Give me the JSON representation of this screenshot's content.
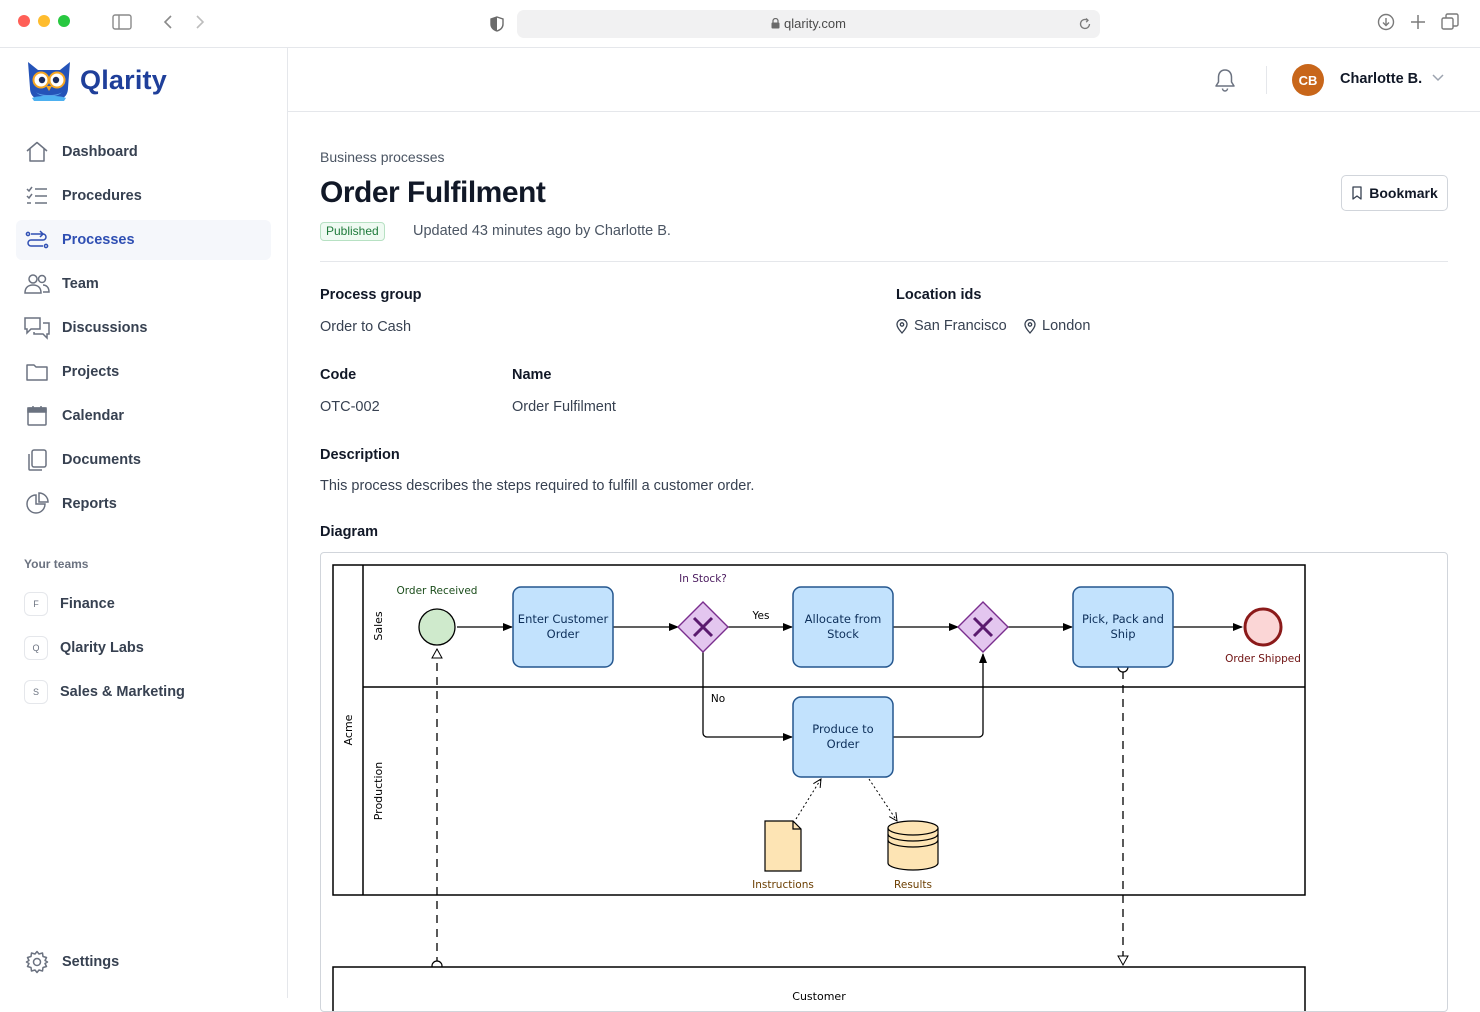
{
  "browser": {
    "url": "qlarity.com"
  },
  "app": {
    "name": "Qlarity"
  },
  "sidebar": {
    "items": [
      {
        "label": "Dashboard",
        "icon": "home-icon"
      },
      {
        "label": "Procedures",
        "icon": "list-check-icon"
      },
      {
        "label": "Processes",
        "icon": "process-flow-icon",
        "active": true
      },
      {
        "label": "Team",
        "icon": "users-icon"
      },
      {
        "label": "Discussions",
        "icon": "chat-bubbles-icon"
      },
      {
        "label": "Projects",
        "icon": "folder-icon"
      },
      {
        "label": "Calendar",
        "icon": "calendar-icon"
      },
      {
        "label": "Documents",
        "icon": "documents-icon"
      },
      {
        "label": "Reports",
        "icon": "pie-chart-icon"
      }
    ],
    "teams_title": "Your teams",
    "teams": [
      {
        "initial": "F",
        "label": "Finance"
      },
      {
        "initial": "Q",
        "label": "Qlarity Labs"
      },
      {
        "initial": "S",
        "label": "Sales & Marketing"
      }
    ],
    "settings_label": "Settings"
  },
  "topbar": {
    "user_initials": "CB",
    "user_name": "Charlotte B."
  },
  "page": {
    "breadcrumb": "Business processes",
    "title": "Order Fulfilment",
    "status": "Published",
    "updated": "Updated 43 minutes ago by Charlotte B.",
    "bookmark_label": "Bookmark",
    "fields": {
      "process_group_label": "Process group",
      "process_group_value": "Order to Cash",
      "location_label": "Location ids",
      "locations": [
        "San Francisco",
        "London"
      ],
      "code_label": "Code",
      "code_value": "OTC-002",
      "name_label": "Name",
      "name_value": "Order Fulfilment",
      "description_label": "Description",
      "description_value": "This process describes the steps required to fulfill a customer order.",
      "diagram_label": "Diagram"
    }
  },
  "diagram": {
    "pool": "Acme",
    "lanes": [
      "Sales",
      "Production"
    ],
    "start_event": "Order Received",
    "task_enter_order": "Enter Customer Order",
    "gateway_label": "In Stock?",
    "yes_label": "Yes",
    "no_label": "No",
    "task_allocate": "Allocate from Stock",
    "task_produce": "Produce to Order",
    "task_ship": "Pick, Pack and Ship",
    "end_event": "Order Shipped",
    "data_object": "Instructions",
    "data_store": "Results",
    "external_pool": "Customer",
    "colors": {
      "task_fill": "#c2e2fd",
      "task_stroke": "#24568e",
      "gateway_fill": "#e3c6ef",
      "gateway_stroke": "#7a2e8e",
      "start_fill": "#cfeacc",
      "end_fill": "#fbd6d6",
      "end_stroke": "#8b1a1a",
      "data_fill": "#fde4b4"
    }
  }
}
